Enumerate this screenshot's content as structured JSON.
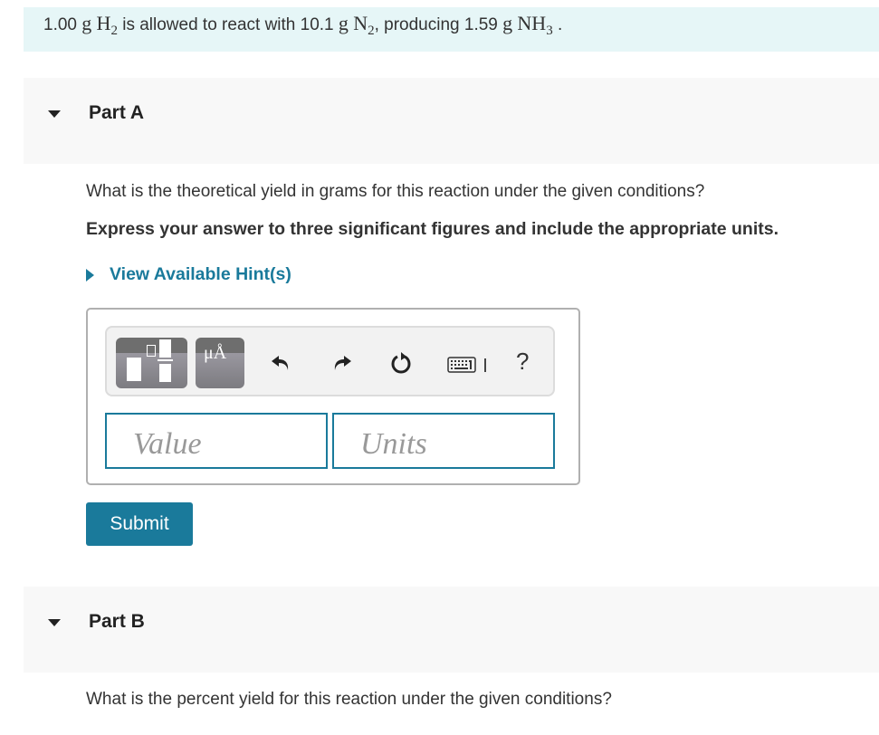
{
  "intro": {
    "mass_h2": "1.00",
    "unit_g": "g",
    "h2_symbol": "H",
    "h2_sub": "2",
    "text_1": " is allowed to react with ",
    "mass_n2": "10.1",
    "n2_symbol": "N",
    "n2_sub": "2",
    "text_2": ", producing ",
    "mass_nh3": "1.59",
    "nh3_symbol": "NH",
    "nh3_sub": "3",
    "text_3": " ."
  },
  "part_a": {
    "title": "Part A",
    "question": "What is the theoretical yield in grams for this reaction under the given conditions?",
    "instruction": "Express your answer to three significant figures and include the appropriate units.",
    "hint_label": "View Available Hint(s)",
    "toolbar": {
      "templates_icon": "templates-icon",
      "units_glyph": "μÅ",
      "undo_icon": "undo-icon",
      "redo_icon": "redo-icon",
      "reset_icon": "reset-icon",
      "keyboard_icon": "keyboard-icon",
      "help_label": "?"
    },
    "value_placeholder": "Value",
    "units_placeholder": "Units",
    "submit_label": "Submit"
  },
  "part_b": {
    "title": "Part B",
    "question": "What is the percent yield for this reaction under the given conditions?"
  },
  "colors": {
    "accent": "#1a7a9b",
    "intro_bg": "#e6f6f7",
    "part_header_bg": "#f8f8f8"
  }
}
